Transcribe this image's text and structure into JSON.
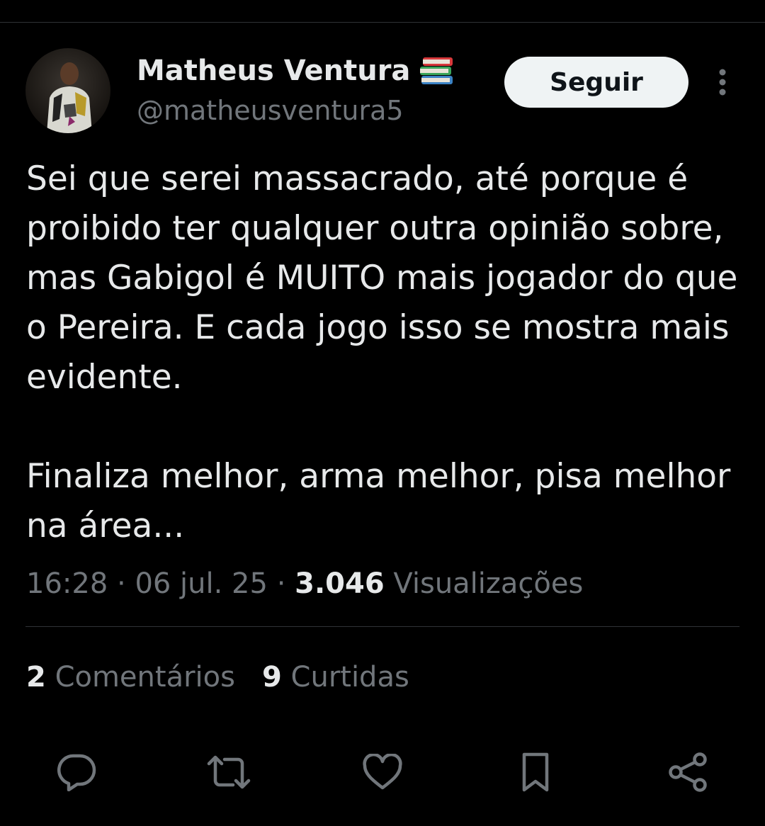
{
  "author": {
    "name": "Matheus Ventura",
    "name_emoji_icon": "books-icon",
    "handle": "@matheusventura5"
  },
  "follow_label": "Seguir",
  "tweet": {
    "paragraph_1": "Sei que serei massacrado, até porque é proibido ter qualquer outra opinião sobre, mas Gabigol é MUITO mais jogador do que o Pereira. E cada jogo isso se mostra mais evidente.",
    "paragraph_2": "Finaliza melhor, arma melhor, pisa melhor na área..."
  },
  "meta": {
    "time": "16:28",
    "date": "06 jul. 25",
    "separator": "·",
    "views_count": "3.046",
    "views_label": "Visualizações"
  },
  "stats": {
    "comments_count": "2",
    "comments_label": "Comentários",
    "likes_count": "9",
    "likes_label": "Curtidas"
  },
  "actions": [
    "reply-icon",
    "retweet-icon",
    "like-icon",
    "bookmark-icon",
    "share-icon"
  ],
  "colors": {
    "background": "#000000",
    "text_primary": "#e7e9ea",
    "text_secondary": "#71767b",
    "divider": "#2f3336",
    "follow_button_bg": "#eff3f4"
  }
}
